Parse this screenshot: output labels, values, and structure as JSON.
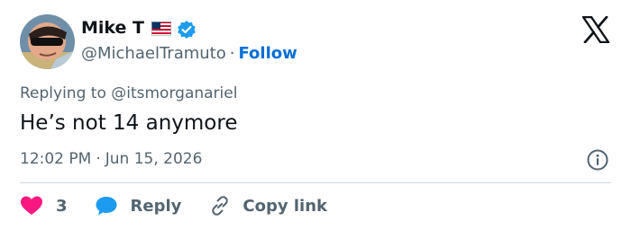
{
  "tweet": {
    "author_name": "Mike T",
    "handle": "@MichaelTramuto",
    "separator": "·",
    "follow_label": "Follow",
    "replying_prefix": "Replying to",
    "replying_to": "@itsmorganariel",
    "text": "He’s not 14 anymore",
    "time": "12:02 PM",
    "date": "Jun 15, 2026",
    "like_count": "3",
    "reply_label": "Reply",
    "copy_link_label": "Copy link"
  },
  "icons": {
    "flag": "us-flag-icon",
    "verified": "verified-badge-icon",
    "brand": "x-logo-icon",
    "info": "info-icon",
    "like": "heart-icon",
    "reply": "reply-bubble-icon",
    "copy": "link-icon"
  },
  "colors": {
    "text": "#0f1419",
    "muted": "#536471",
    "accent": "#006fd6",
    "verified": "#1d9bf0",
    "like": "#f91880",
    "divider": "#cfd9de"
  }
}
